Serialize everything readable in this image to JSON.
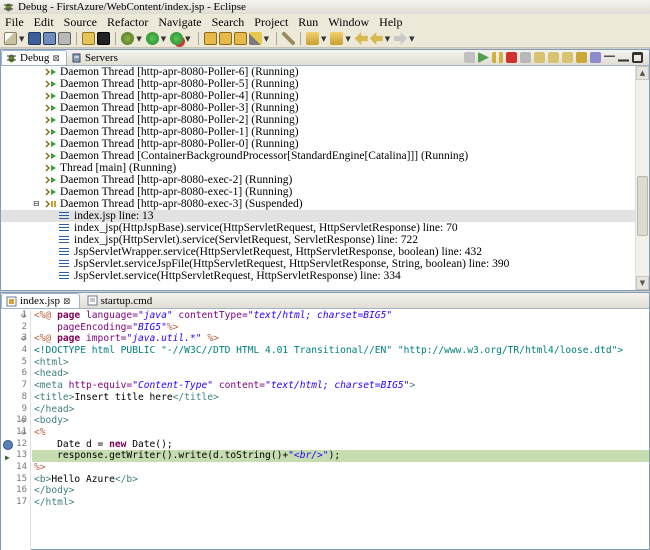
{
  "window": {
    "title": "Debug - FirstAzure/WebContent/index.jsp - Eclipse"
  },
  "menu": [
    "File",
    "Edit",
    "Source",
    "Refactor",
    "Navigate",
    "Search",
    "Project",
    "Run",
    "Window",
    "Help"
  ],
  "debug_view": {
    "tabs": [
      {
        "label": "Debug",
        "active": true,
        "close": "⊠"
      },
      {
        "label": "Servers",
        "active": false
      }
    ],
    "threads": [
      {
        "label": "Daemon Thread [http-apr-8080-Poller-6] (Running)"
      },
      {
        "label": "Daemon Thread [http-apr-8080-Poller-5] (Running)"
      },
      {
        "label": "Daemon Thread [http-apr-8080-Poller-4] (Running)"
      },
      {
        "label": "Daemon Thread [http-apr-8080-Poller-3] (Running)"
      },
      {
        "label": "Daemon Thread [http-apr-8080-Poller-2] (Running)"
      },
      {
        "label": "Daemon Thread [http-apr-8080-Poller-1] (Running)"
      },
      {
        "label": "Daemon Thread [http-apr-8080-Poller-0] (Running)"
      },
      {
        "label": "Daemon Thread [ContainerBackgroundProcessor[StandardEngine[Catalina]]] (Running)"
      },
      {
        "label": "Thread [main] (Running)"
      },
      {
        "label": "Daemon Thread [http-apr-8080-exec-2] (Running)"
      },
      {
        "label": "Daemon Thread [http-apr-8080-exec-1] (Running)"
      },
      {
        "label": "Daemon Thread [http-apr-8080-exec-3] (Suspended)",
        "expanded": true,
        "toggle": "⊟"
      }
    ],
    "frames": [
      {
        "label": "index.jsp line: 13",
        "selected": true
      },
      {
        "label": "index_jsp(HttpJspBase).service(HttpServletRequest, HttpServletResponse) line: 70"
      },
      {
        "label": "index_jsp(HttpServlet).service(ServletRequest, ServletResponse) line: 722"
      },
      {
        "label": "JspServletWrapper.service(HttpServletRequest, HttpServletResponse, boolean) line: 432"
      },
      {
        "label": "JspServlet.serviceJspFile(HttpServletRequest, HttpServletResponse, String, boolean) line: 390"
      },
      {
        "label": "JspServlet.service(HttpServletRequest, HttpServletResponse) line: 334"
      }
    ]
  },
  "editor": {
    "tabs": [
      {
        "label": "index.jsp",
        "active": true,
        "close": "⊠"
      },
      {
        "label": "startup.cmd",
        "active": false
      }
    ],
    "line_numbers": [
      "1",
      "2",
      "3",
      "4",
      "5",
      "6",
      "7",
      "8",
      "9",
      "10",
      "11",
      "12",
      "13",
      "14",
      "15",
      "16",
      "17"
    ],
    "fold_marks": {
      "1": "⊖",
      "3": "⊖",
      "10": "⊖",
      "11": "⊖"
    },
    "current_line": 13,
    "breakpoint_line": 12,
    "code": [
      [
        {
          "t": "<%@ ",
          "c": "jsp"
        },
        {
          "t": "page ",
          "c": "kw"
        },
        {
          "t": "language=",
          "c": "attr"
        },
        {
          "t": "\"java\" ",
          "c": "str"
        },
        {
          "t": "contentType=",
          "c": "attr"
        },
        {
          "t": "\"text/html; charset=BIG5\"",
          "c": "str"
        }
      ],
      [
        {
          "t": "    pageEncoding=",
          "c": "attr"
        },
        {
          "t": "\"BIG5\"",
          "c": "str"
        },
        {
          "t": "%>",
          "c": "jsp"
        }
      ],
      [
        {
          "t": "<%@ ",
          "c": "jsp"
        },
        {
          "t": "page ",
          "c": "kw"
        },
        {
          "t": "import=",
          "c": "attr"
        },
        {
          "t": "\"java.util.*\" ",
          "c": "str"
        },
        {
          "t": "%>",
          "c": "jsp"
        }
      ],
      [
        {
          "t": "<!DOCTYPE html PUBLIC \"-//W3C//DTD HTML 4.01 Transitional//EN\" \"http://www.w3.org/TR/html4/loose.dtd\">",
          "c": "doc"
        }
      ],
      [
        {
          "t": "<html>",
          "c": "tag"
        }
      ],
      [
        {
          "t": "<head>",
          "c": "tag"
        }
      ],
      [
        {
          "t": "<meta ",
          "c": "tag"
        },
        {
          "t": "http-equiv=",
          "c": "attr"
        },
        {
          "t": "\"Content-Type\" ",
          "c": "str"
        },
        {
          "t": "content=",
          "c": "attr"
        },
        {
          "t": "\"text/html; charset=BIG5\"",
          "c": "str"
        },
        {
          "t": ">",
          "c": "tag"
        }
      ],
      [
        {
          "t": "<title>",
          "c": "tag"
        },
        {
          "t": "Insert title here",
          "c": "plain"
        },
        {
          "t": "</title>",
          "c": "tag"
        }
      ],
      [
        {
          "t": "</head>",
          "c": "tag"
        }
      ],
      [
        {
          "t": "<body>",
          "c": "tag"
        }
      ],
      [
        {
          "t": "<%",
          "c": "jsp"
        }
      ],
      [
        {
          "t": "    Date d = ",
          "c": "plain"
        },
        {
          "t": "new ",
          "c": "kw"
        },
        {
          "t": "Date();",
          "c": "plain"
        }
      ],
      [
        {
          "t": "    response.getWriter().write(d.toString()+",
          "c": "plain"
        },
        {
          "t": "\"<br/>\"",
          "c": "str"
        },
        {
          "t": ");",
          "c": "plain"
        }
      ],
      [
        {
          "t": "%>",
          "c": "jsp"
        }
      ],
      [
        {
          "t": "<b>",
          "c": "tag"
        },
        {
          "t": "Hello Azure",
          "c": "plain"
        },
        {
          "t": "</b>",
          "c": "tag"
        }
      ],
      [
        {
          "t": "</body>",
          "c": "tag"
        }
      ],
      [
        {
          "t": "</html>",
          "c": "tag"
        }
      ]
    ]
  }
}
